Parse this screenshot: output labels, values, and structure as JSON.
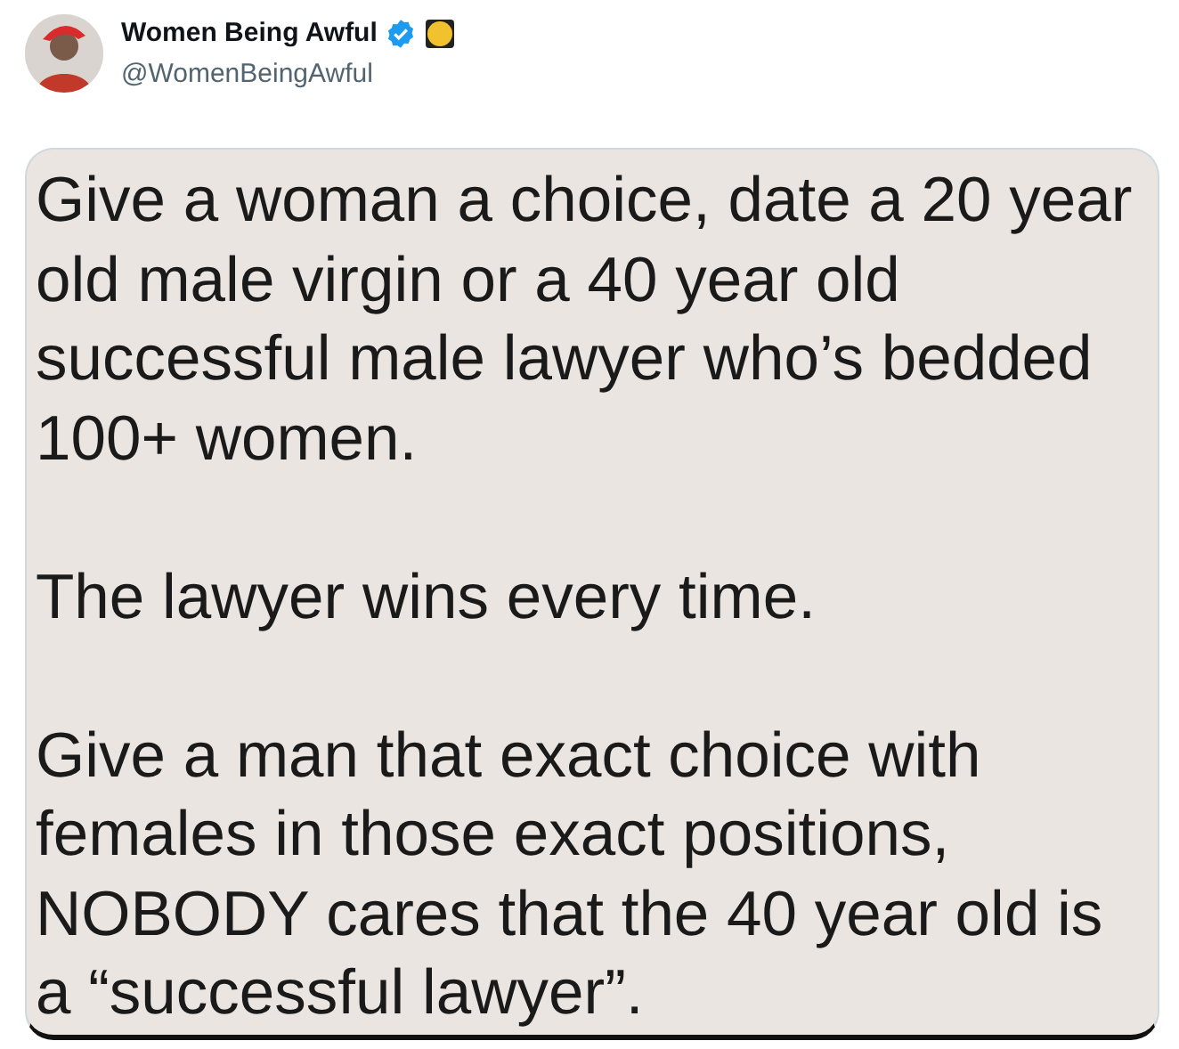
{
  "author": {
    "name": "Women Being Awful",
    "verified": true,
    "handle": "@WomenBeingAwful"
  },
  "image_text": {
    "paragraphs": [
      {
        "lines": [
          "Give a woman a choice, date a 20 year",
          "old male virgin or a 40 year old",
          "successful male lawyer who’s bedded",
          "100+ women."
        ]
      },
      {
        "lines": [
          "The lawyer wins every time."
        ]
      },
      {
        "lines": [
          "Give a man that exact choice with",
          "females in those exact positions,",
          "NOBODY cares that the 40 year old is",
          "a “successful lawyer”."
        ]
      }
    ]
  }
}
